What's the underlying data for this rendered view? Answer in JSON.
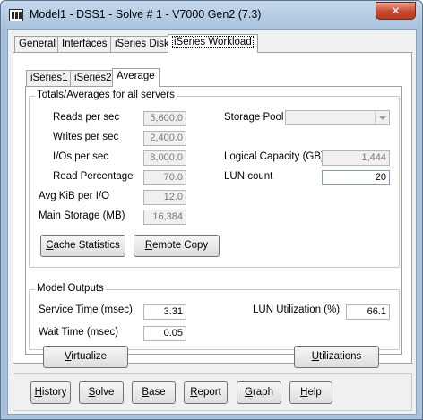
{
  "window": {
    "title": "Model1 - DSS1 - Solve # 1 - V7000 Gen2 (7.3)",
    "close_symbol": "✕"
  },
  "main_tabs": [
    {
      "label": "General",
      "active": false
    },
    {
      "label": "Interfaces",
      "active": false
    },
    {
      "label": "iSeries Disk",
      "active": false
    },
    {
      "label": "iSeries Workload",
      "active": true
    }
  ],
  "sub_tabs": [
    {
      "label": "iSeries1",
      "active": false
    },
    {
      "label": "iSeries2",
      "active": false
    },
    {
      "label": "Average",
      "active": true
    }
  ],
  "totals": {
    "title": "Totals/Averages for all servers",
    "reads_per_sec": {
      "label": "Reads per sec",
      "value": "5,600.0"
    },
    "writes_per_sec": {
      "label": "Writes per sec",
      "value": "2,400.0"
    },
    "ios_per_sec": {
      "label": "I/Os per sec",
      "value": "8,000.0"
    },
    "read_percentage": {
      "label": "Read Percentage",
      "value": "70.0"
    },
    "avg_kib_per_io": {
      "label": "Avg KiB per I/O",
      "value": "12.0"
    },
    "main_storage": {
      "label": "Main Storage (MB)",
      "value": "16,384"
    },
    "storage_pool": {
      "label": "Storage Pool",
      "value": ""
    },
    "logical_capacity": {
      "label": "Logical Capacity (GB)",
      "value": "1,444"
    },
    "lun_count": {
      "label": "LUN count",
      "value": "20"
    },
    "cache_statistics": {
      "prefix": "",
      "underline": "C",
      "rest": "ache Statistics"
    },
    "remote_copy": {
      "prefix": "",
      "underline": "R",
      "rest": "emote Copy"
    }
  },
  "outputs": {
    "title": "Model Outputs",
    "service_time": {
      "label": "Service Time (msec)",
      "value": "3.31"
    },
    "wait_time": {
      "label": "Wait Time (msec)",
      "value": "0.05"
    },
    "lun_utilization": {
      "label": "LUN Utilization (%)",
      "value": "66.1"
    }
  },
  "actions": {
    "virtualize": {
      "underline": "V",
      "rest": "irtualize",
      "prefix": ""
    },
    "utilizations": {
      "prefix": "",
      "underline": "U",
      "rest": "tilizations"
    }
  },
  "bottom_buttons": {
    "history": {
      "prefix": "",
      "underline": "H",
      "rest": "istory"
    },
    "solve": {
      "prefix": "",
      "underline": "S",
      "rest": "olve"
    },
    "base": {
      "prefix": "",
      "underline": "B",
      "rest": "ase"
    },
    "report": {
      "prefix": "",
      "underline": "R",
      "rest": "eport"
    },
    "graph": {
      "prefix": "",
      "underline": "G",
      "rest": "raph"
    },
    "help": {
      "prefix": "",
      "underline": "H",
      "rest": "elp"
    }
  },
  "icons": {
    "app": "app-icon",
    "close": "close-icon",
    "dropdown": "chevron-down-icon"
  },
  "colors": {
    "frame": "#a9c3dd",
    "close_button": "#c8472c",
    "panel": "#ffffff",
    "surface": "#f0f0f0"
  }
}
